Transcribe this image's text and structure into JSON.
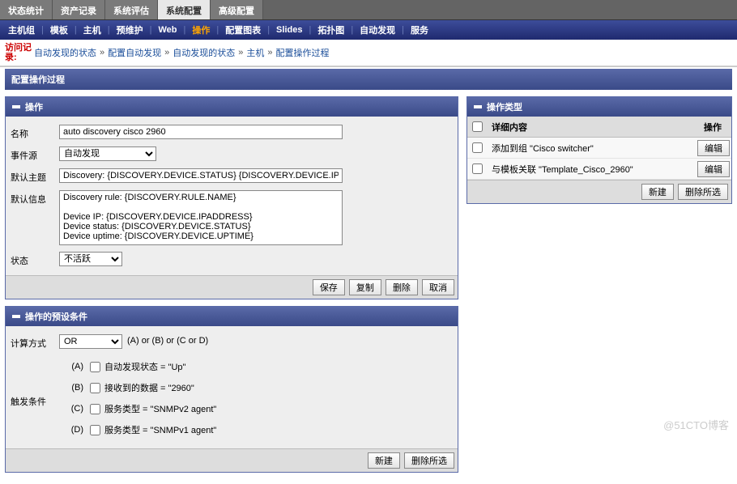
{
  "topTabs": {
    "items": [
      "状态统计",
      "资产记录",
      "系统评估",
      "系统配置",
      "高级配置"
    ],
    "active": 3
  },
  "subTabs": {
    "items": [
      "主机组",
      "模板",
      "主机",
      "预维护",
      "Web",
      "操作",
      "配置图表",
      "Slides",
      "拓扑图",
      "自动发现",
      "服务"
    ],
    "active": 5
  },
  "history": {
    "label": "访问记录:",
    "items": [
      "自动发现的状态",
      "配置自动发现",
      "自动发现的状态",
      "主机",
      "配置操作过程"
    ]
  },
  "pageTitle": "配置操作过程",
  "opPanel": {
    "title": "操作",
    "rows": {
      "nameLabel": "名称",
      "nameValue": "auto discovery cisco 2960",
      "eventSourceLabel": "事件源",
      "eventSourceValue": "自动发现",
      "defaultSubjectLabel": "默认主题",
      "defaultSubjectValue": "Discovery: {DISCOVERY.DEVICE.STATUS} {DISCOVERY.DEVICE.IPADDRESS}",
      "defaultInfoLabel": "默认信息",
      "defaultInfoValue": "Discovery rule: {DISCOVERY.RULE.NAME}\n\nDevice IP: {DISCOVERY.DEVICE.IPADDRESS}\nDevice status: {DISCOVERY.DEVICE.STATUS}\nDevice uptime: {DISCOVERY.DEVICE.UPTIME}",
      "statusLabel": "状态",
      "statusValue": "不活跃"
    },
    "buttons": {
      "save": "保存",
      "copy": "复制",
      "delete": "删除",
      "cancel": "取消"
    }
  },
  "condPanel": {
    "title": "操作的预设条件",
    "calcLabel": "计算方式",
    "calcValue": "OR",
    "calcHint": "(A) or (B) or (C or D)",
    "triggerLabel": "触发条件",
    "rows": [
      {
        "key": "(A)",
        "text": "自动发现状态 = \"Up\""
      },
      {
        "key": "(B)",
        "text": "接收到的数据 = \"2960\""
      },
      {
        "key": "(C)",
        "text": "服务类型 = \"SNMPv2 agent\""
      },
      {
        "key": "(D)",
        "text": "服务类型 = \"SNMPv1 agent\""
      }
    ],
    "buttons": {
      "new": "新建",
      "deleteSel": "删除所选"
    }
  },
  "opTypePanel": {
    "title": "操作类型",
    "headers": {
      "detail": "详细内容",
      "op": "操作"
    },
    "editLabel": "编辑",
    "rows": [
      "添加到组 \"Cisco switcher\"",
      "与模板关联 \"Template_Cisco_2960\""
    ],
    "buttons": {
      "new": "新建",
      "deleteSel": "删除所选"
    }
  },
  "watermark": "@51CTO博客"
}
